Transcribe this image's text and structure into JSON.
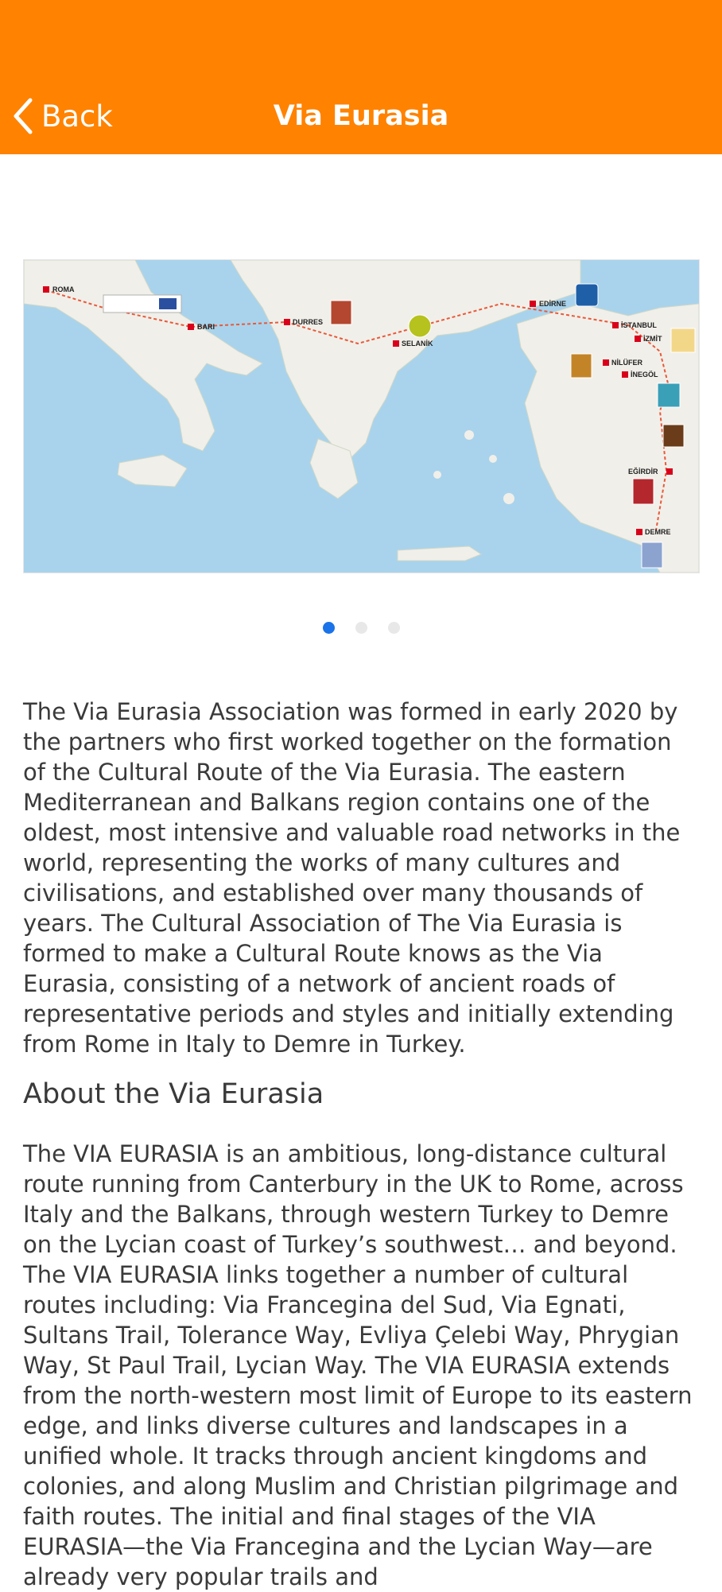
{
  "nav": {
    "back_label": "Back",
    "title": "Via Eurasia",
    "bar_color": "#ff8200",
    "back_icon": "chevron-left-icon"
  },
  "carousel": {
    "page_count": 3,
    "active_page": 1,
    "active_dot_color": "#1a73e8",
    "map_labels": {
      "roma": "ROMA",
      "bari": "BARI",
      "durres": "DURRES",
      "selanik": "SELANİK",
      "edirne": "EDİRNE",
      "istanbul": "İSTANBUL",
      "izmit": "İZMİT",
      "nilufer": "NİLÜFER",
      "inegol": "İNEGÖL",
      "egirdir": "EĞİRDİR",
      "demre": "DEMRE"
    }
  },
  "content": {
    "intro_paragraph": "The Via Eurasia Association was formed in early 2020 by the partners who first worked together on the formation of the Cultural Route of the Via Eurasia. The eastern Mediterranean and Balkans region contains one of the oldest, most intensive and valuable road networks in the world, representing the works of many cultures and civilisations, and established over many thousands of years. The Cultural Association of The Via Eurasia is formed to make a Cultural Route knows as the Via Eurasia, consisting of a network of ancient roads of representative periods and styles and initially extending from Rome in Italy to Demre in Turkey.",
    "about_heading": "About the Via Eurasia",
    "about_paragraph": "The VIA EURASIA is an ambitious, long-distance cultural route running from Canterbury in the UK to Rome, across Italy and the Balkans, through western Turkey to Demre on the Lycian coast of Turkey’s southwest… and beyond. The VIA EURASIA links together a number of cultural routes including: Via Francegina del Sud, Via Egnati, Sultans Trail, Tolerance Way, Evliya Çelebi Way, Phrygian Way, St Paul Trail, Lycian Way. The VIA EURASIA extends from the north-western most limit of Europe to its eastern edge, and links diverse cultures and landscapes in a unified whole. It tracks through ancient kingdoms and colonies, and along Muslim and Christian pilgrimage and faith routes. The initial and final stages of the VIA EURASIA—the Via Francegina and the Lycian Way—are already very popular trails and"
  }
}
